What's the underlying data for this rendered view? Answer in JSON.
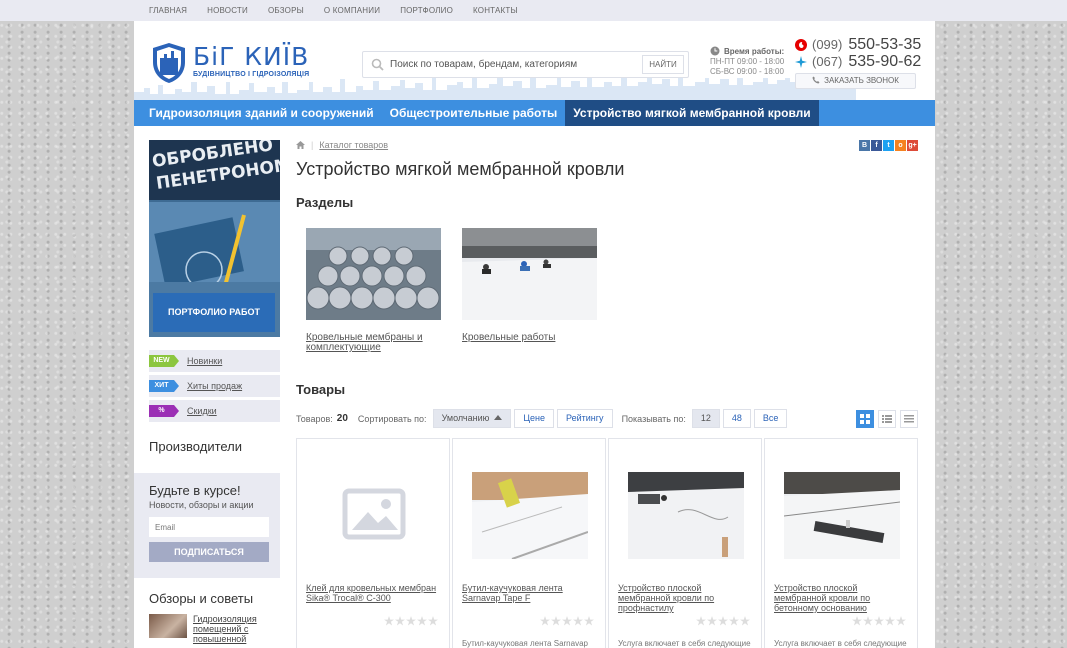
{
  "topnav": [
    "ГЛАВНАЯ",
    "НОВОСТИ",
    "ОБЗОРЫ",
    "О КОМПАНИИ",
    "ПОРТФОЛИО",
    "КОНТАКТЫ"
  ],
  "logo": {
    "title": "БіГ КИЇВ",
    "subtitle": "БУДІВНИЦТВО І ГІДРОІЗОЛЯЦІЯ"
  },
  "search": {
    "placeholder": "Поиск по товарам, брендам, категориям",
    "button": "НАЙТИ"
  },
  "hours": {
    "label": "Время работы:",
    "weekdays": "ПН-ПТ 09:00 - 18:00",
    "weekend": "СБ-ВС 09:00 - 18:00"
  },
  "phones": [
    {
      "code": "(099)",
      "number": "550-53-35"
    },
    {
      "code": "(067)",
      "number": "535-90-62"
    }
  ],
  "callback": "ЗАКАЗАТЬ ЗВОНОК",
  "mainnav": [
    {
      "label": "Гидроизоляция зданий и сооружений"
    },
    {
      "label": "Общестроительные работы"
    },
    {
      "label": "Устройство мягкой мембранной кровли"
    }
  ],
  "sidebar": {
    "banner_button": "ПОРТФОЛИО РАБОТ",
    "tags": [
      {
        "badge": "NEW",
        "label": "Новинки",
        "color": "#8cc63f"
      },
      {
        "badge": "ХИТ",
        "label": "Хиты продаж",
        "color": "#3d8fe0"
      },
      {
        "badge": "%",
        "label": "Скидки",
        "color": "#9b2fb5"
      }
    ],
    "manufacturers": "Производители",
    "subscribe": {
      "title": "Будьте в курсе!",
      "subtitle": "Новости, обзоры и акции",
      "placeholder": "Email",
      "button": "ПОДПИСАТЬСЯ"
    },
    "reviews_title": "Обзоры и советы",
    "review_item": "Гидроизоляция помещений с повышенной"
  },
  "breadcrumb": {
    "item": "Каталог товаров"
  },
  "share_icons": [
    "В",
    "f",
    "t",
    "о",
    "g+"
  ],
  "page_title": "Устройство мягкой мембранной кровли",
  "sections_title": "Разделы",
  "categories": [
    {
      "label": "Кровельные мембраны и комплектующие",
      "icon": "membrane-rolls-image"
    },
    {
      "label": "Кровельные работы",
      "icon": "roof-works-image"
    }
  ],
  "goods_title": "Товары",
  "toolbar": {
    "count_label": "Товаров:",
    "count": "20",
    "sort_label": "Сортировать по:",
    "sort_options": [
      "Умолчанию",
      "Цене",
      "Рейтингу"
    ],
    "show_label": "Показывать по:",
    "show_options": [
      "12",
      "48",
      "Все"
    ]
  },
  "products": [
    {
      "title": "Клей для кровельных мембран Sika® Trocal® C-300",
      "desc": ""
    },
    {
      "title": "Бутил-каучуковая лента Sarnavap Tape F",
      "desc": "Бутил-каучуковая лента Sarnavap Tape F применяется для надежного и герметичного соединения"
    },
    {
      "title": "Устройство плоской мембранной кровли по профнастилу",
      "desc": "Услуга включает в себя следующие работы: подготовка поверхности, проверка и усиление креплений"
    },
    {
      "title": "Устройство плоской мембранной кровли по бетонному основанию",
      "desc": "Услуга включает в себя следующие работы: подготовка поверхности, очистка от непрочного бетона"
    }
  ]
}
